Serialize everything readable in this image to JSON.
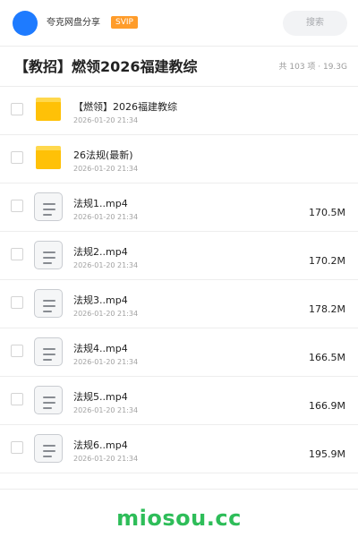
{
  "header": {
    "user_name": "夸克网盘分享",
    "badge": "SVIP",
    "search_placeholder": "搜索"
  },
  "page": {
    "title": "【教招】燃领2026福建教综",
    "summary": "共 103 项 · 19.3G"
  },
  "files": [
    {
      "name": "【燃领】2026福建教综",
      "date": "2026-01-20 21:34",
      "size": "",
      "type": "folder"
    },
    {
      "name": "26法规(最新)",
      "date": "2026-01-20 21:34",
      "size": "",
      "type": "folder"
    },
    {
      "name": "法规1..mp4",
      "date": "2026-01-20 21:34",
      "size": "170.5M",
      "type": "video"
    },
    {
      "name": "法规2..mp4",
      "date": "2026-01-20 21:34",
      "size": "170.2M",
      "type": "video"
    },
    {
      "name": "法规3..mp4",
      "date": "2026-01-20 21:34",
      "size": "178.2M",
      "type": "video"
    },
    {
      "name": "法规4..mp4",
      "date": "2026-01-20 21:34",
      "size": "166.5M",
      "type": "video"
    },
    {
      "name": "法规5..mp4",
      "date": "2026-01-20 21:34",
      "size": "166.9M",
      "type": "video"
    },
    {
      "name": "法规6..mp4",
      "date": "2026-01-20 21:34",
      "size": "195.9M",
      "type": "video"
    }
  ],
  "footer": {
    "brand": "miosou.cc"
  },
  "colors": {
    "avatar": "#1e7bff",
    "badge": "#ff9c2a",
    "folder": "#ffc107",
    "brand": "#2ebd59"
  },
  "icons": {
    "folder": "folder-icon",
    "video": "video-file-icon"
  }
}
